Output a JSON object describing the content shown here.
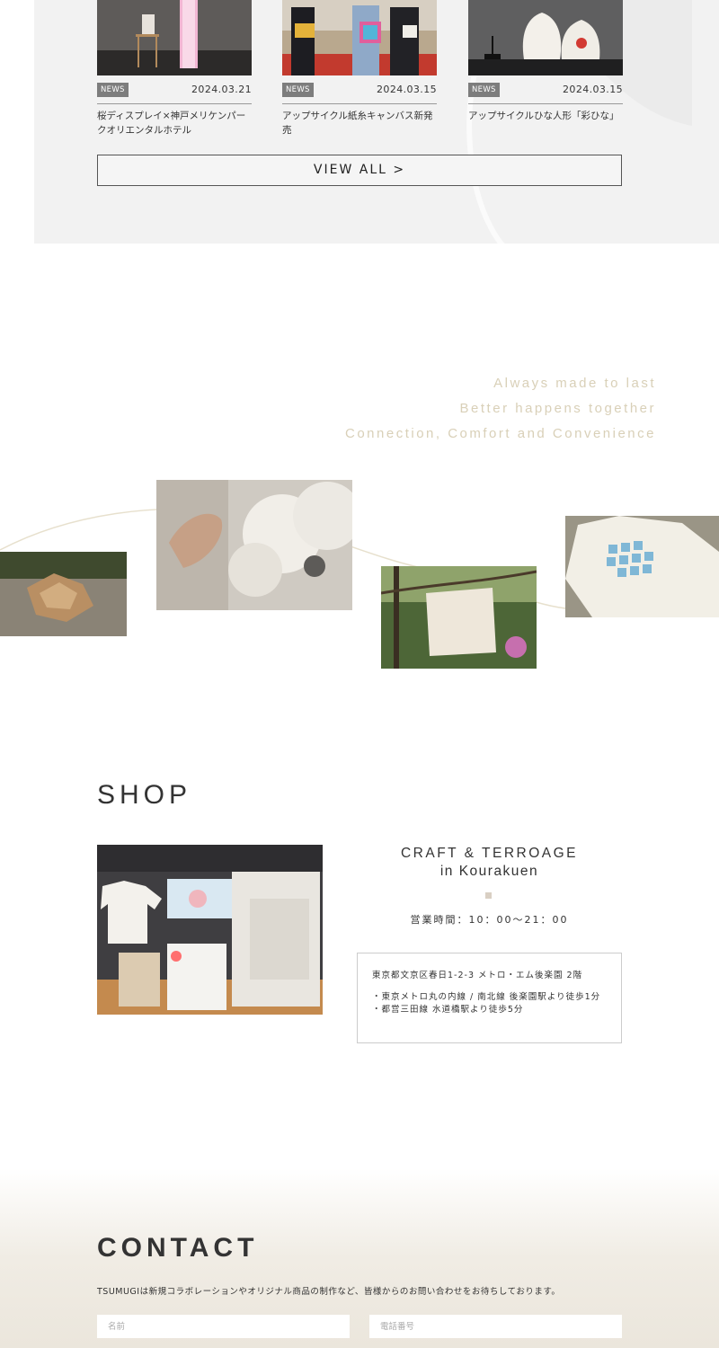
{
  "news": {
    "items": [
      {
        "tag": "NEWS",
        "date": "2024.03.21",
        "title": "桜ディスプレイ×神戸メリケンパークオリエンタルホテル"
      },
      {
        "tag": "NEWS",
        "date": "2024.03.15",
        "title": "アップサイクル紙糸キャンバス新発売"
      },
      {
        "tag": "NEWS",
        "date": "2024.03.15",
        "title": "アップサイクルひな人形「彩ひな」"
      }
    ],
    "view_all_label": "VIEW ALL >"
  },
  "tagline": {
    "lines": [
      "Always made to last",
      "Better happens together",
      "Connection, Comfort and Convenience"
    ],
    "color": "#d9d0b8"
  },
  "shop": {
    "heading": "SHOP",
    "name_line1": "CRAFT & TERROAGE",
    "name_line2": "in Kourakuen",
    "hours": "営業時間：10：00〜21：00",
    "address": "東京都文京区春日1-2-3 メトロ・エム後楽園 2階",
    "access": [
      "・東京メトロ丸の内線 / 南北線 後楽園駅より徒歩1分",
      "・都営三田線 水道橋駅より徒歩5分"
    ]
  },
  "contact": {
    "heading": "CONTACT",
    "intro": "TSUMUGIは新規コラボレーションやオリジナル商品の制作など、皆様からのお問い合わせをお待ちしております。",
    "name_placeholder": "名前",
    "phone_placeholder": "電話番号"
  }
}
